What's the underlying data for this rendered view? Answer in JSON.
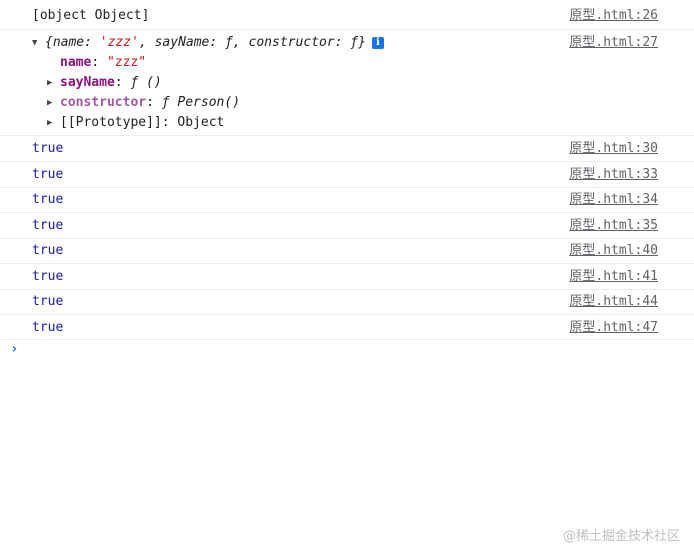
{
  "console": {
    "entry1": {
      "text": "[object Object]",
      "source": "原型.html:26"
    },
    "entry2": {
      "summary": {
        "open": "{",
        "k1": "name",
        "v1": "'zzz'",
        "k2": "sayName",
        "v2": "ƒ",
        "k3": "constructor",
        "v3": "ƒ",
        "close": "}",
        "badge": "i"
      },
      "source": "原型.html:27",
      "props": [
        {
          "key": "name",
          "sep": ": ",
          "value": "\"zzz\""
        },
        {
          "key": "sayName",
          "sep": ": ",
          "value": "ƒ ()"
        },
        {
          "key": "constructor",
          "sep": ": ",
          "value": "ƒ Person()"
        },
        {
          "key": "[[Prototype]]",
          "sep": ": ",
          "value": "Object"
        }
      ]
    },
    "true_entries": [
      {
        "value": "true",
        "source": "原型.html:30"
      },
      {
        "value": "true",
        "source": "原型.html:33"
      },
      {
        "value": "true",
        "source": "原型.html:34"
      },
      {
        "value": "true",
        "source": "原型.html:35"
      },
      {
        "value": "true",
        "source": "原型.html:40"
      },
      {
        "value": "true",
        "source": "原型.html:41"
      },
      {
        "value": "true",
        "source": "原型.html:44"
      },
      {
        "value": "true",
        "source": "原型.html:47"
      }
    ],
    "prompt_glyph": "›"
  },
  "watermark": "@稀土掘金技术社区"
}
